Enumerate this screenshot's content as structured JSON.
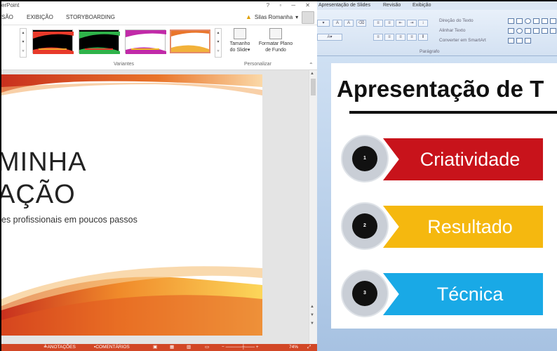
{
  "left_app": {
    "title_fragment": "erPoint",
    "tabs": [
      "SÃO",
      "EXIBIÇÃO",
      "STORYBOARDING"
    ],
    "user_name": "Silas Romanha",
    "ribbon": {
      "group_variants": "Variantes",
      "group_customize": "Personalizar",
      "btn_slide_size_line1": "Tamanho",
      "btn_slide_size_line2": "do Slide",
      "btn_format_bg_line1": "Formatar Plano",
      "btn_format_bg_line2": "de Fundo"
    },
    "slide": {
      "title_line1": "MINHA",
      "title_line2": "AÇÃO",
      "subtitle": "es profissionais em poucos passos"
    },
    "statusbar": {
      "notes": "ANOTAÇÕES",
      "comments": "COMENTÁRIOS",
      "zoom": "74%"
    }
  },
  "right_app": {
    "tabs": [
      "Apresentação de Slides",
      "Revisão",
      "Exibição"
    ],
    "ribbon": {
      "text_direction": "Direção do Texto",
      "align_text": "Alinhar Texto",
      "convert_smartart": "Converter em SmartArt",
      "group_paragraph": "Parágrafo"
    },
    "slide": {
      "title": "Apresentação de T",
      "items": [
        {
          "number": "1",
          "label": "Criatividade",
          "color": "#c8131b"
        },
        {
          "number": "2",
          "label": "Resultado",
          "color": "#f5b80f"
        },
        {
          "number": "3",
          "label": "Técnica",
          "color": "#19a9e6"
        }
      ]
    }
  },
  "colors": {
    "accent_orange": "#d24726",
    "office_blue": "#c9d9ed"
  }
}
